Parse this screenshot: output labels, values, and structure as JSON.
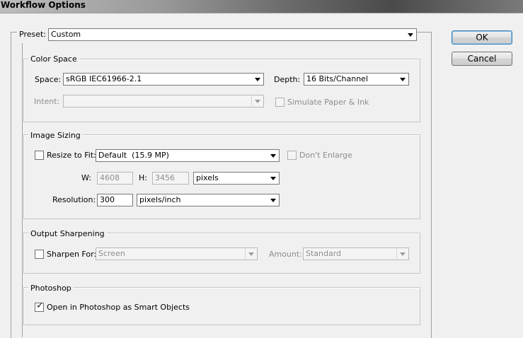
{
  "window": {
    "title": "Workflow Options"
  },
  "preset": {
    "label": "Preset:",
    "value": "Custom"
  },
  "buttons": {
    "ok": "OK",
    "cancel": "Cancel"
  },
  "color_space": {
    "title": "Color Space",
    "space_label": "Space:",
    "space_value": "sRGB IEC61966-2.1",
    "depth_label": "Depth:",
    "depth_value": "16 Bits/Channel",
    "intent_label": "Intent:",
    "intent_value": "",
    "simulate_label": "Simulate Paper & Ink",
    "simulate_checked": false
  },
  "image_sizing": {
    "title": "Image Sizing",
    "resize_label": "Resize to Fit:",
    "resize_checked": false,
    "resize_value": "Default  (15.9 MP)",
    "dont_enlarge_label": "Don't Enlarge",
    "dont_enlarge_checked": false,
    "w_label": "W:",
    "w_value": "4608",
    "h_label": "H:",
    "h_value": "3456",
    "units_value": "pixels",
    "resolution_label": "Resolution:",
    "resolution_value": "300",
    "resolution_units_value": "pixels/inch"
  },
  "output_sharpening": {
    "title": "Output Sharpening",
    "sharpen_label": "Sharpen For:",
    "sharpen_checked": false,
    "sharpen_value": "Screen",
    "amount_label": "Amount:",
    "amount_value": "Standard"
  },
  "photoshop": {
    "title": "Photoshop",
    "smart_objects_label": "Open in Photoshop as Smart Objects",
    "smart_objects_checked": true
  }
}
